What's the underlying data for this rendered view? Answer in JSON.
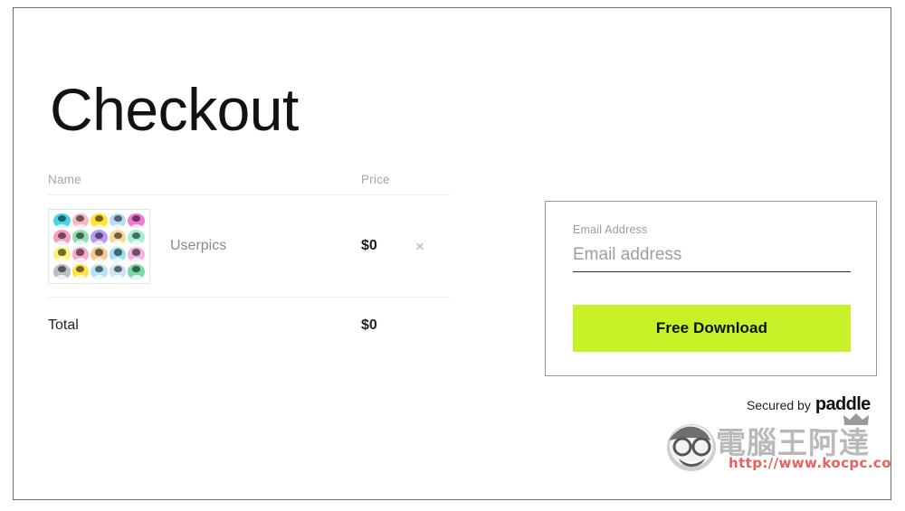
{
  "page": {
    "title": "Checkout",
    "background": "#ffffff",
    "frame_border_color": "#6e6e6e"
  },
  "order_table": {
    "columns": {
      "name": "Name",
      "price": "Price"
    },
    "items": [
      {
        "name": "Userpics",
        "price": "$0",
        "remove_label": "×",
        "thumbnail": {
          "type": "avatar-grid",
          "rows": 4,
          "cols": 5,
          "avatar_colors": [
            "#46d6e8",
            "#f5b9bc",
            "#ffe234",
            "#b9d9f5",
            "#f078d6",
            "#f79dc4",
            "#8fe0b1",
            "#b89ef2",
            "#f8d89a",
            "#a8ecd0",
            "#fff27a",
            "#f9a8cf",
            "#f6c98f",
            "#9fe2ef",
            "#f2b5e0",
            "#b9bfc9",
            "#ffe24a",
            "#b6e4f7",
            "#cfe2f5",
            "#76dba6"
          ]
        }
      }
    ],
    "total": {
      "label": "Total",
      "value": "$0"
    }
  },
  "payment_panel": {
    "email_label": "Email Address",
    "email_placeholder": "Email address",
    "email_value": "",
    "cta_label": "Free Download",
    "cta_color": "#c6f227"
  },
  "secured": {
    "prefix": "Secured by",
    "brand": "paddle"
  },
  "watermark": {
    "name_cn": "電腦王阿達",
    "url": "http://www.kocpc.com.tw",
    "url_color": "#e8605f",
    "name_color": "#b9b9b9"
  }
}
